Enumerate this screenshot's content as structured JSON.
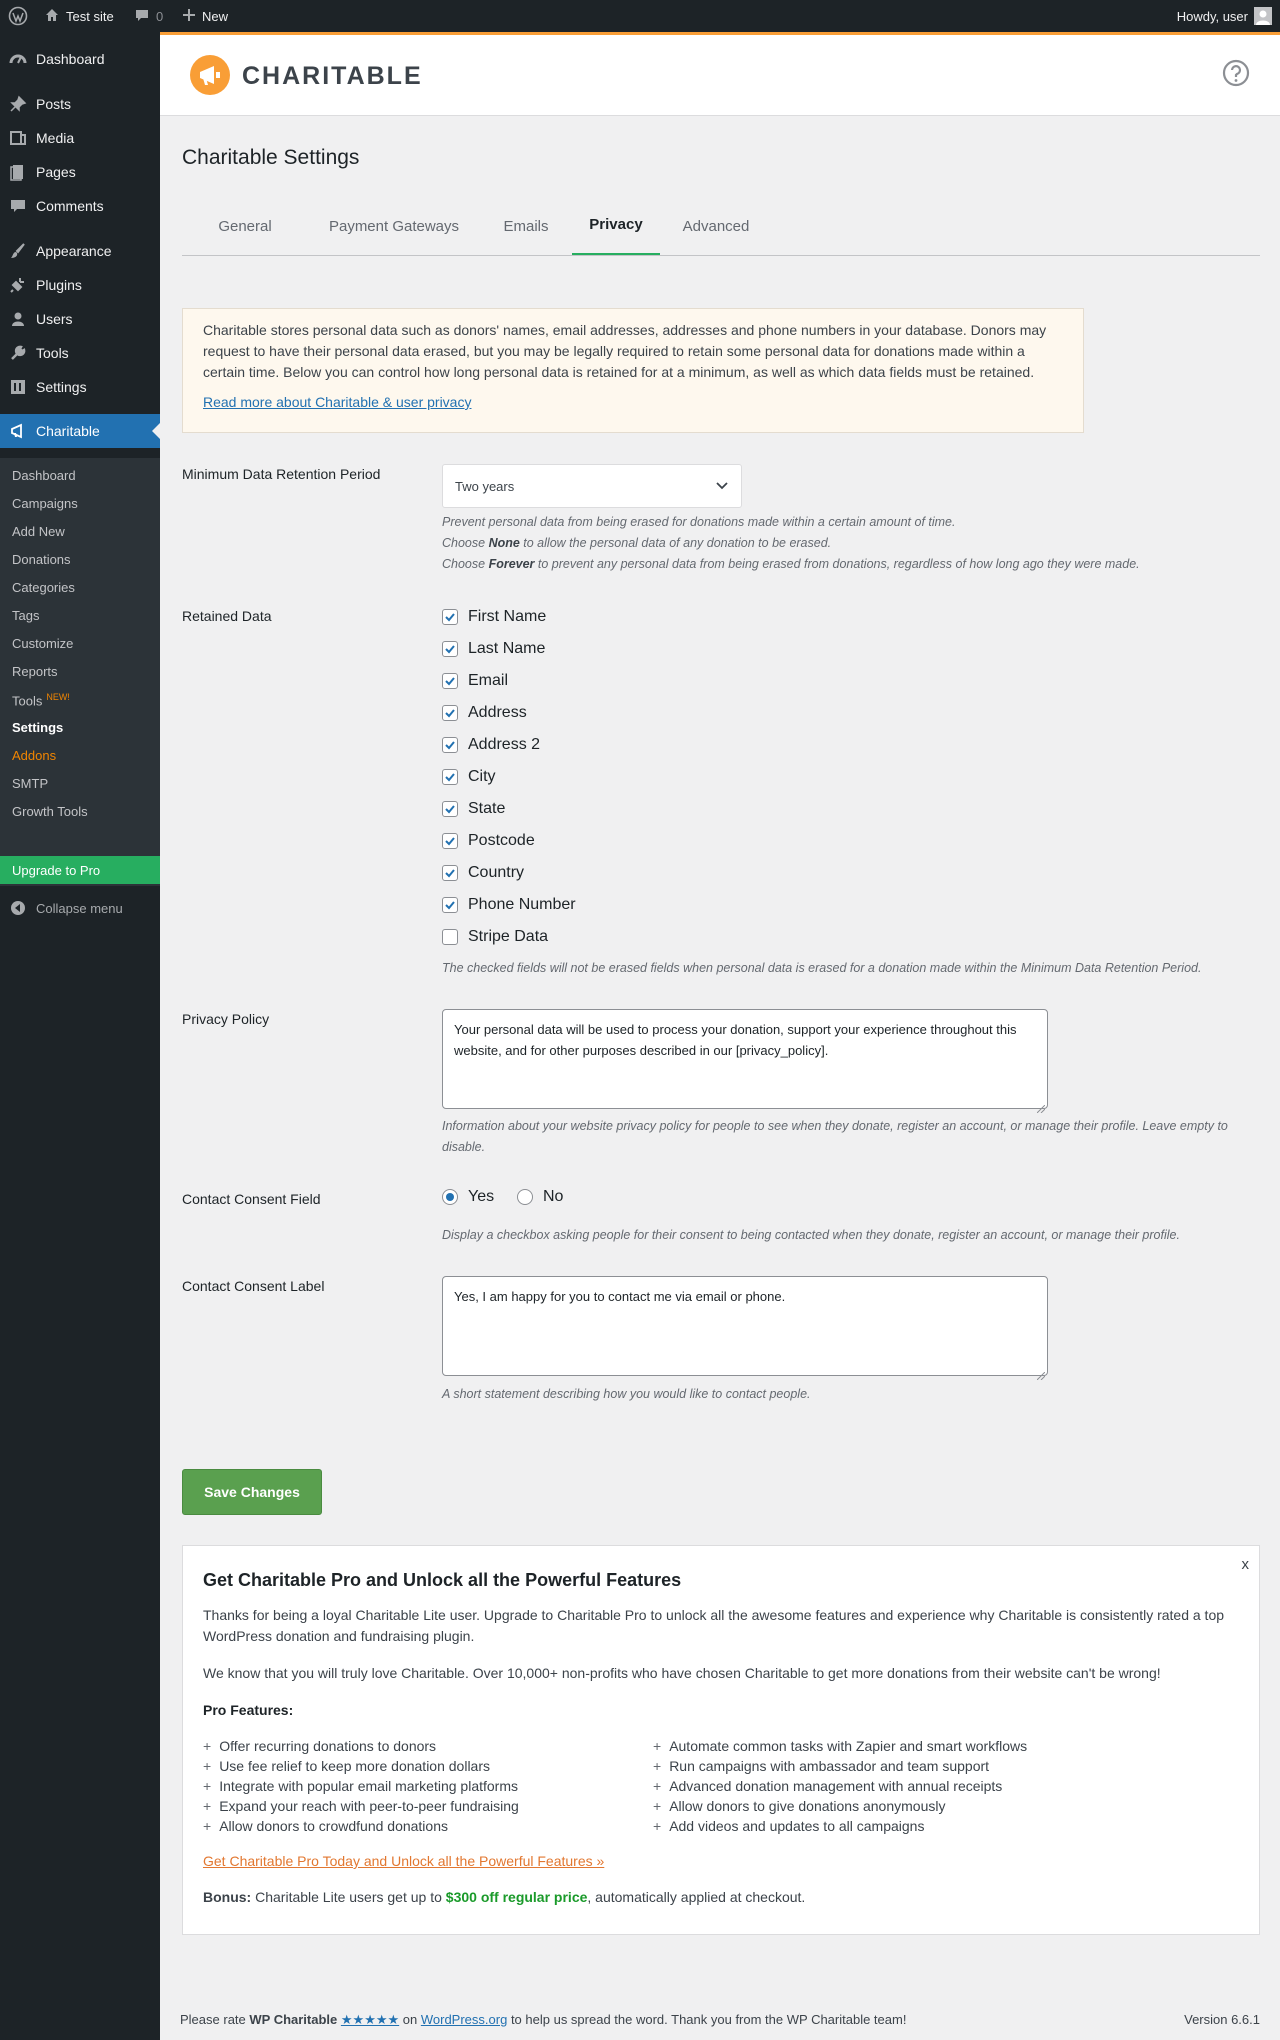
{
  "admin_bar": {
    "site_name": "Test site",
    "comments_count": "0",
    "new_label": "New",
    "howdy": "Howdy, user"
  },
  "sidebar": {
    "items": [
      {
        "label": "Dashboard",
        "icon": "dashboard-icon"
      },
      {
        "label": "Posts",
        "icon": "pin-icon"
      },
      {
        "label": "Media",
        "icon": "media-icon"
      },
      {
        "label": "Pages",
        "icon": "page-icon"
      },
      {
        "label": "Comments",
        "icon": "comment-icon"
      },
      {
        "label": "Appearance",
        "icon": "brush-icon"
      },
      {
        "label": "Plugins",
        "icon": "plug-icon"
      },
      {
        "label": "Users",
        "icon": "user-icon"
      },
      {
        "label": "Tools",
        "icon": "wrench-icon"
      },
      {
        "label": "Settings",
        "icon": "settings-icon"
      },
      {
        "label": "Charitable",
        "icon": "megaphone-icon"
      }
    ],
    "submenu": [
      "Dashboard",
      "Campaigns",
      "Add New",
      "Donations",
      "Categories",
      "Tags",
      "Customize",
      "Reports",
      "Tools",
      "Settings",
      "Addons",
      "SMTP",
      "Growth Tools"
    ],
    "new_badge": "NEW!",
    "upgrade": "Upgrade to Pro",
    "collapse": "Collapse menu"
  },
  "header": {
    "logo_text": "CHARITABLE"
  },
  "page": {
    "title": "Charitable Settings",
    "tabs": [
      "General",
      "Payment Gateways",
      "Emails",
      "Privacy",
      "Advanced"
    ]
  },
  "notice": {
    "text": "Charitable stores personal data such as donors' names, email addresses, addresses and phone numbers in your database. Donors may request to have their personal data erased, but you may be legally required to retain some personal data for donations made within a certain time. Below you can control how long personal data is retained for at a minimum, as well as which data fields must be retained.",
    "link": "Read more about Charitable & user privacy"
  },
  "retention": {
    "label": "Minimum Data Retention Period",
    "value": "Two years",
    "desc1": "Prevent personal data from being erased for donations made within a certain amount of time.",
    "desc2_pre": "Choose ",
    "desc2_bold": "None",
    "desc2_post": " to allow the personal data of any donation to be erased.",
    "desc3_pre": "Choose ",
    "desc3_bold": "Forever",
    "desc3_post": " to prevent any personal data from being erased from donations, regardless of how long ago they were made."
  },
  "retained": {
    "label": "Retained Data",
    "fields": [
      {
        "label": "First Name",
        "checked": true
      },
      {
        "label": "Last Name",
        "checked": true
      },
      {
        "label": "Email",
        "checked": true
      },
      {
        "label": "Address",
        "checked": true
      },
      {
        "label": "Address 2",
        "checked": true
      },
      {
        "label": "City",
        "checked": true
      },
      {
        "label": "State",
        "checked": true
      },
      {
        "label": "Postcode",
        "checked": true
      },
      {
        "label": "Country",
        "checked": true
      },
      {
        "label": "Phone Number",
        "checked": true
      },
      {
        "label": "Stripe Data",
        "checked": false
      }
    ],
    "desc": "The checked fields will not be erased fields when personal data is erased for a donation made within the Minimum Data Retention Period."
  },
  "privacy_policy": {
    "label": "Privacy Policy",
    "value": "Your personal data will be used to process your donation, support your experience throughout this website, and for other purposes described in our [privacy_policy].",
    "desc": "Information about your website privacy policy for people to see when they donate, register an account, or manage their profile. Leave empty to disable."
  },
  "consent_field": {
    "label": "Contact Consent Field",
    "yes": "Yes",
    "no": "No",
    "selected": "Yes",
    "desc": "Display a checkbox asking people for their consent to being contacted when they donate, register an account, or manage their profile."
  },
  "consent_label": {
    "label": "Contact Consent Label",
    "value": "Yes, I am happy for you to contact me via email or phone.",
    "desc": "A short statement describing how you would like to contact people."
  },
  "save_label": "Save Changes",
  "promo": {
    "close": "x",
    "title": "Get Charitable Pro and Unlock all the Powerful Features",
    "p1": "Thanks for being a loyal Charitable Lite user. Upgrade to Charitable Pro to unlock all the awesome features and experience why Charitable is consistently rated a top WordPress donation and fundraising plugin.",
    "p2": "We know that you will truly love Charitable. Over 10,000+ non-profits who have chosen Charitable to get more donations from their website can't be wrong!",
    "features_label": "Pro Features:",
    "features_left": [
      "Offer recurring donations to donors",
      "Use fee relief to keep more donation dollars",
      "Integrate with popular email marketing platforms",
      "Expand your reach with peer-to-peer fundraising",
      "Allow donors to crowdfund donations"
    ],
    "features_right": [
      "Automate common tasks with Zapier and smart workflows",
      "Run campaigns with ambassador and team support",
      "Advanced donation management with annual receipts",
      "Allow donors to give donations anonymously",
      "Add videos and updates to all campaigns"
    ],
    "link": "Get Charitable Pro Today and Unlock all the Powerful Features »",
    "bonus_label": "Bonus:",
    "bonus_pre": " Charitable Lite users get up to ",
    "bonus_amount": "$300 off regular price",
    "bonus_post": ", automatically applied at checkout."
  },
  "footer": {
    "pre": "Please rate ",
    "plugin": "WP Charitable",
    "stars": "★★★★★",
    "on": " on ",
    "wporg": "WordPress.org",
    "post": " to help us spread the word. Thank you from the WP Charitable team!",
    "version": "Version 6.6.1"
  },
  "colors": {
    "accent": "#2271b1",
    "brand_orange": "#f99e36",
    "save_green": "#5aa04f",
    "upgrade_green": "#27ae60"
  }
}
